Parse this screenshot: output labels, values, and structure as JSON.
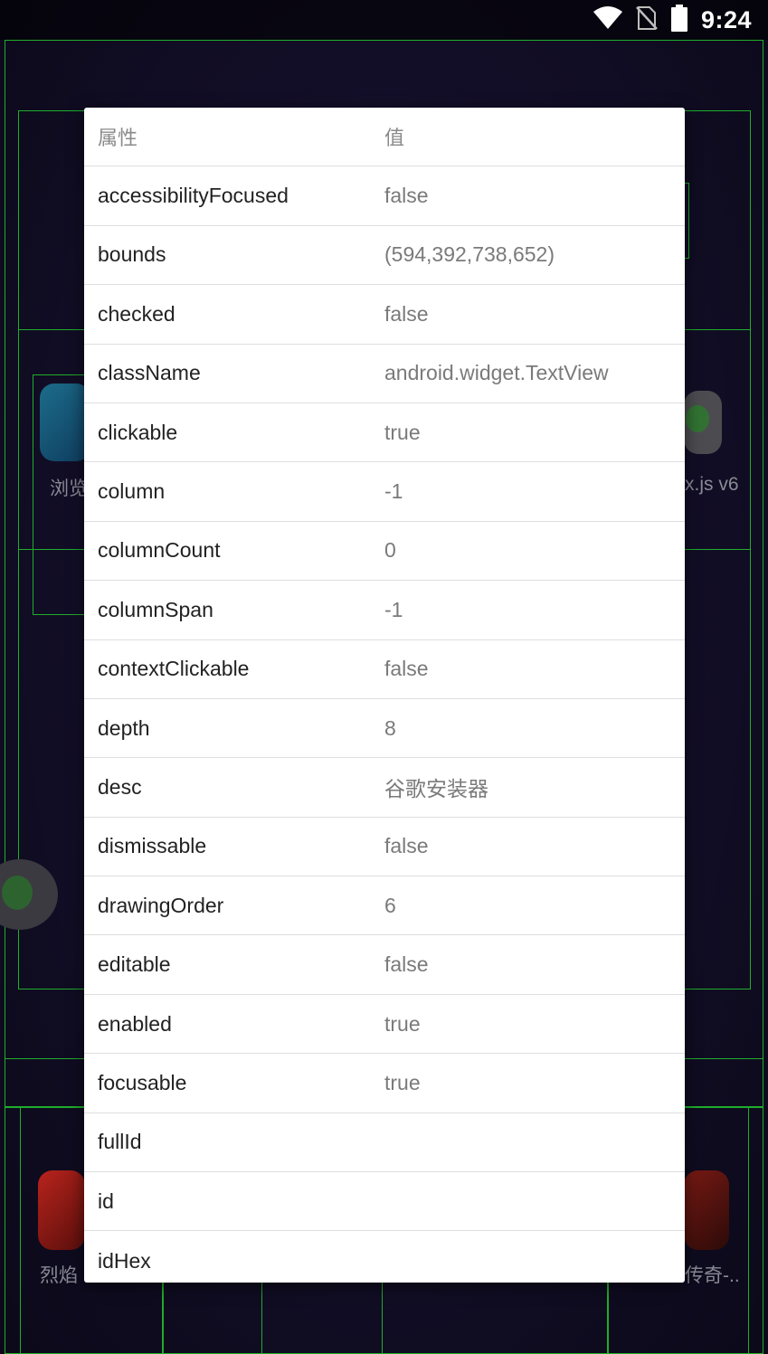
{
  "status_bar": {
    "time": "9:24",
    "icons": [
      "wifi-icon",
      "no-sim-icon",
      "battery-icon"
    ]
  },
  "background": {
    "apps": [
      {
        "label": "浏览",
        "icon": "browser-app-icon"
      },
      {
        "label": "x.js v6",
        "icon": "autox-app-icon"
      },
      {
        "label": "烈焰",
        "icon": "game-app-icon"
      },
      {
        "label": "传奇-..",
        "icon": "game-app-icon"
      }
    ],
    "accent_color": "#1fae2a"
  },
  "dialog": {
    "header": {
      "key": "属性",
      "value": "值"
    },
    "rows": [
      {
        "key": "accessibilityFocused",
        "value": "false"
      },
      {
        "key": "bounds",
        "value": "(594,392,738,652)"
      },
      {
        "key": "checked",
        "value": "false"
      },
      {
        "key": "className",
        "value": "android.widget.TextView"
      },
      {
        "key": "clickable",
        "value": "true"
      },
      {
        "key": "column",
        "value": "-1"
      },
      {
        "key": "columnCount",
        "value": "0"
      },
      {
        "key": "columnSpan",
        "value": "-1"
      },
      {
        "key": "contextClickable",
        "value": "false"
      },
      {
        "key": "depth",
        "value": "8"
      },
      {
        "key": "desc",
        "value": "谷歌安装器"
      },
      {
        "key": "dismissable",
        "value": "false"
      },
      {
        "key": "drawingOrder",
        "value": "6"
      },
      {
        "key": "editable",
        "value": "false"
      },
      {
        "key": "enabled",
        "value": "true"
      },
      {
        "key": "focusable",
        "value": "true"
      },
      {
        "key": "fullId",
        "value": ""
      },
      {
        "key": "id",
        "value": ""
      },
      {
        "key": "idHex",
        "value": ""
      }
    ]
  }
}
